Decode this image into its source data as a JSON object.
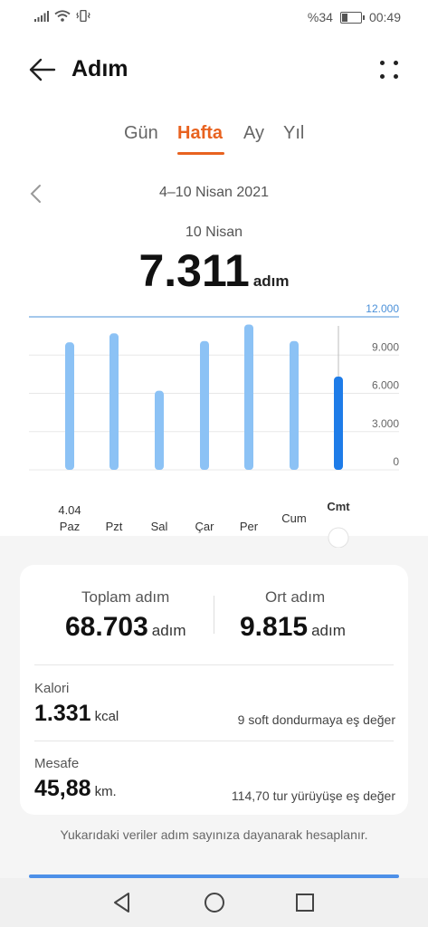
{
  "status_bar": {
    "battery": "%34",
    "time": "00:49"
  },
  "header": {
    "title": "Adım"
  },
  "tabs": [
    {
      "label": "Gün",
      "active": false
    },
    {
      "label": "Hafta",
      "active": true
    },
    {
      "label": "Ay",
      "active": false
    },
    {
      "label": "Yıl",
      "active": false
    }
  ],
  "date_range": "4–10 Nisan 2021",
  "selected": {
    "date": "10 Nisan",
    "value": "7.311",
    "unit": "adım"
  },
  "chart_data": {
    "type": "bar",
    "categories": [
      "Paz",
      "Pzt",
      "Sal",
      "Çar",
      "Per",
      "Cum",
      "Cmt"
    ],
    "first_date_label": "4.04",
    "values": [
      10000,
      10700,
      6200,
      10100,
      11400,
      10100,
      7311
    ],
    "selected_index": 6,
    "ylim": [
      0,
      12000
    ],
    "yticks": [
      "0",
      "3.000",
      "6.000",
      "9.000",
      "12.000"
    ],
    "goal_line": "12.000",
    "colors": {
      "bar": "#8cc2f5",
      "selected": "#1e7ce8",
      "goal": "#4a90d9",
      "grid": "#e8e8e8"
    }
  },
  "summary": {
    "total": {
      "label": "Toplam adım",
      "value": "68.703",
      "unit": "adım"
    },
    "average": {
      "label": "Ort adım",
      "value": "9.815",
      "unit": "adım"
    }
  },
  "calories": {
    "label": "Kalori",
    "value": "1.331",
    "unit": "kcal",
    "note": "9 soft dondurmaya eş değer"
  },
  "distance": {
    "label": "Mesafe",
    "value": "45,88",
    "unit": "km.",
    "note": "114,70 tur yürüyüşe eş değer"
  },
  "footnote": "Yukarıdaki veriler adım sayınıza dayanarak hesaplanır."
}
